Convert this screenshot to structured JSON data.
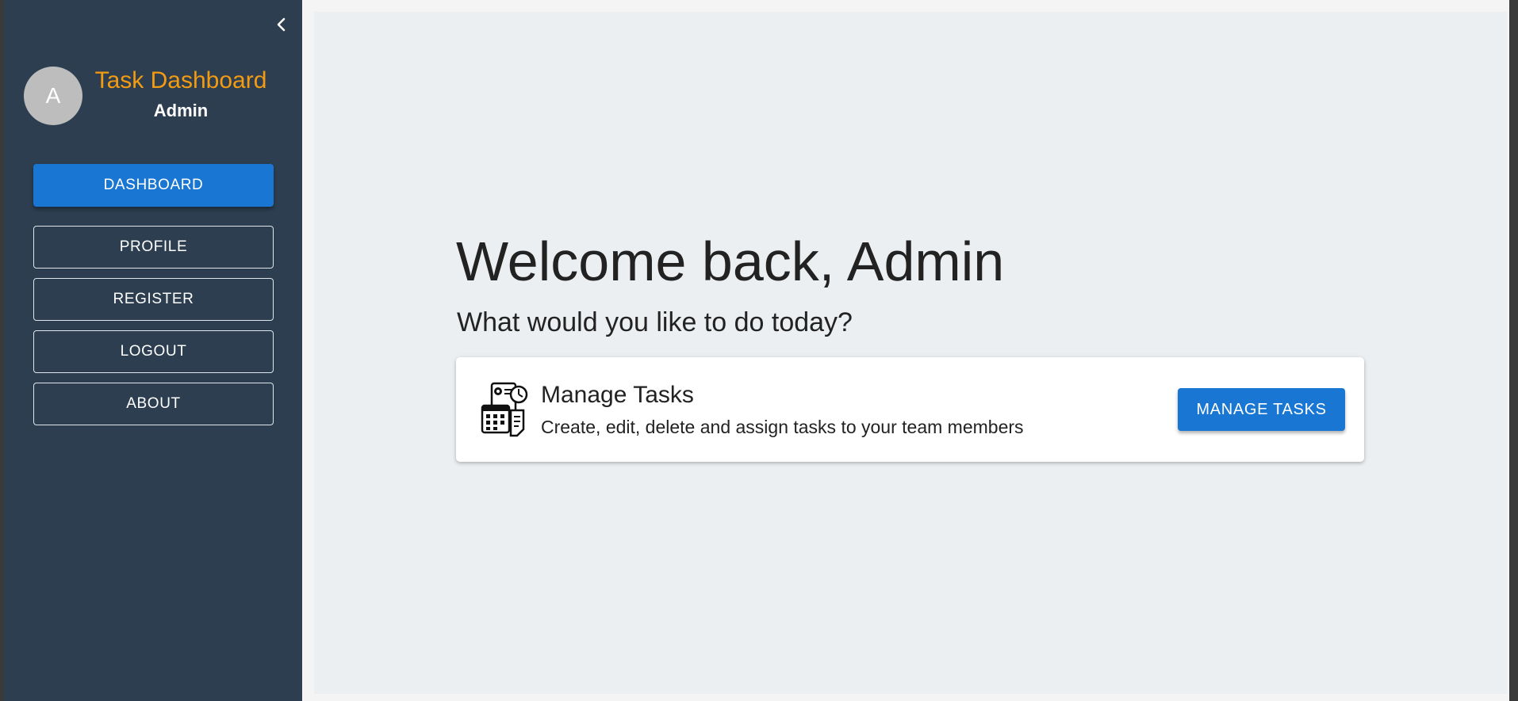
{
  "sidebar": {
    "avatar_initial": "A",
    "title": "Task Dashboard",
    "role": "Admin",
    "collapse_icon": "chevron-left-icon",
    "items": [
      {
        "label": "DASHBOARD",
        "active": true
      },
      {
        "label": "PROFILE"
      },
      {
        "label": "REGISTER"
      },
      {
        "label": "LOGOUT"
      },
      {
        "label": "ABOUT"
      }
    ]
  },
  "main": {
    "welcome": "Welcome back, Admin",
    "subtitle": "What would you like to do today?",
    "card": {
      "icon": "task-calendar-icon",
      "title": "Manage Tasks",
      "description": "Create, edit, delete and assign tasks to your team members",
      "button_label": "MANAGE TASKS"
    }
  },
  "colors": {
    "sidebar_bg": "#2c3e50",
    "brand_title": "#f39c12",
    "primary": "#1976d2",
    "main_bg": "#eceff1"
  }
}
